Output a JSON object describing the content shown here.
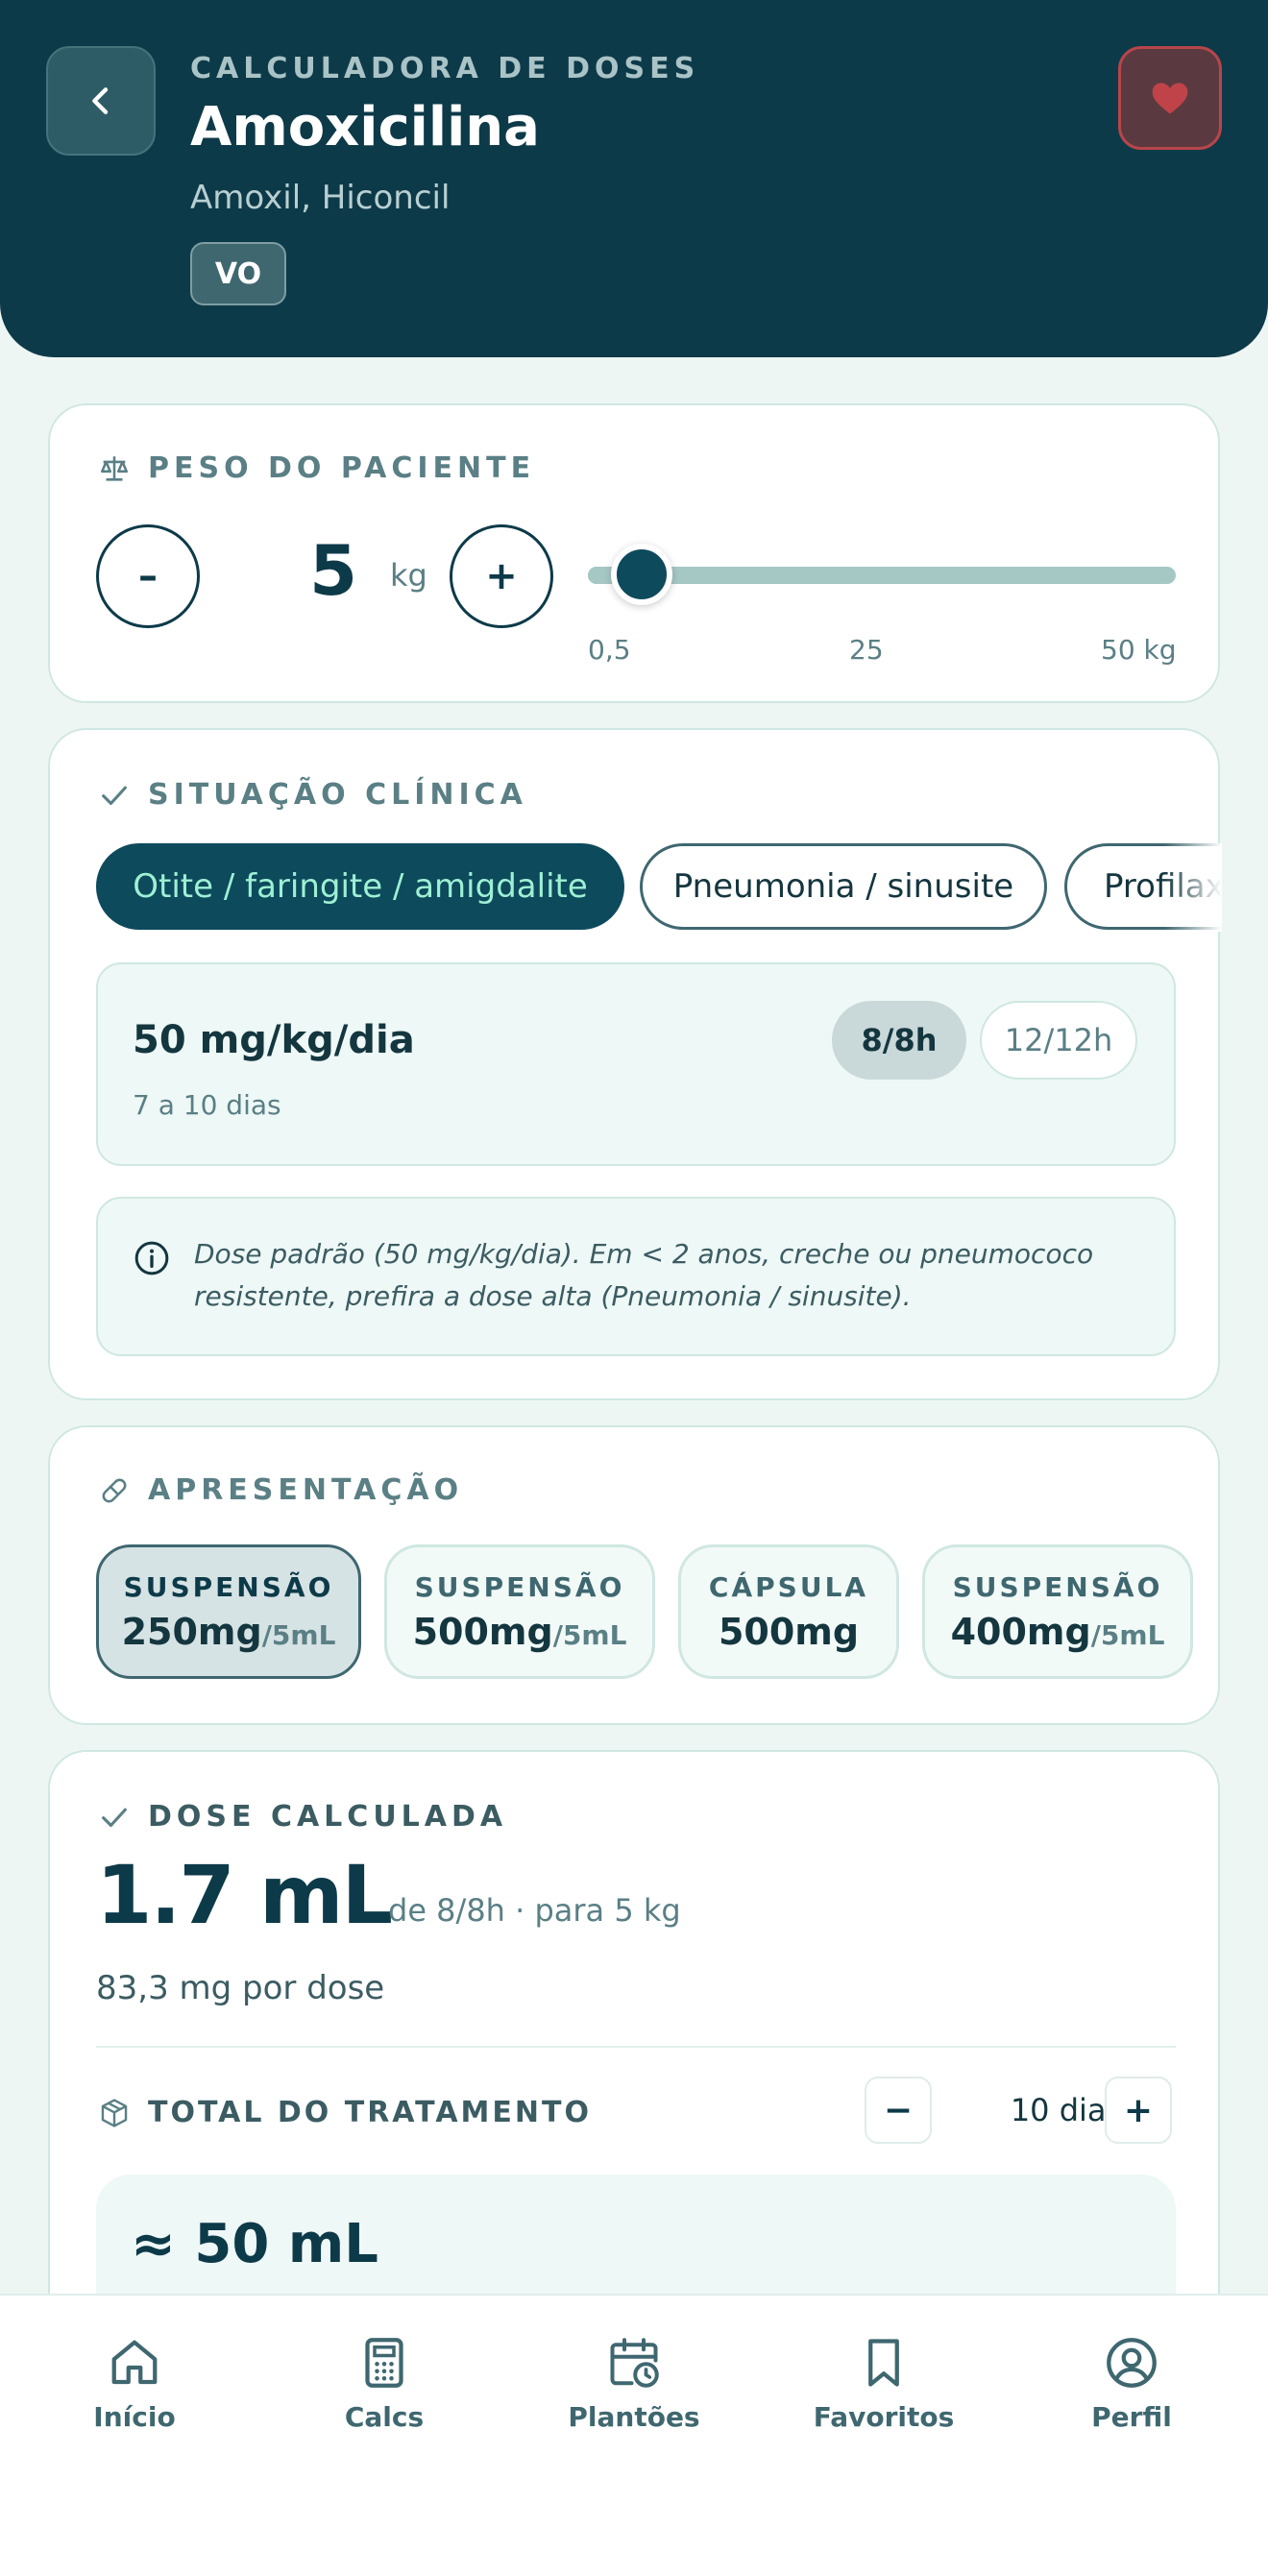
{
  "header": {
    "kicker": "CALCULADORA DE DOSES",
    "drug_name": "Amoxicilina",
    "brands": "Amoxil, Hiconcil",
    "route": "VO",
    "accent": "#0d3a49",
    "favorite_color": "#c0434a"
  },
  "weight": {
    "title": "PESO DO PACIENTE",
    "minus": "–",
    "plus": "+",
    "value": "5",
    "unit": "kg",
    "slider_value_kg": 5,
    "slider_min_kg": 0.5,
    "slider_max_kg": 50,
    "ticks": [
      "0,5",
      "25",
      "50 kg"
    ]
  },
  "clinical": {
    "title": "SITUAÇÃO CLÍNICA",
    "chips": [
      "Otite / faringite / amigdalite",
      "Pneumonia / sinusite",
      "Profilaxia"
    ],
    "dose_rule": "50 mg/kg/dia",
    "duration": "7 a 10 dias",
    "intervals": [
      "8/8h",
      "12/12h"
    ],
    "info": "Dose padrão (50 mg/kg/dia). Em < 2 anos, creche ou pneumococo resistente, prefira a dose alta (Pneumonia / sinusite)."
  },
  "presentation": {
    "title": "APRESENTAÇÃO",
    "items": [
      {
        "type": "SUSPENSÃO",
        "amount": "250mg",
        "per": "/5mL"
      },
      {
        "type": "SUSPENSÃO",
        "amount": "500mg",
        "per": "/5mL"
      },
      {
        "type": "CÁPSULA",
        "amount": "500mg",
        "per": ""
      },
      {
        "type": "SUSPENSÃO",
        "amount": "400mg",
        "per": "/5mL"
      }
    ]
  },
  "result": {
    "title": "DOSE CALCULADA",
    "dose": "1.7 mL",
    "context": "de 8/8h · para 5 kg",
    "per_dose": "83,3 mg por dose",
    "total_title": "TOTAL DO TRATAMENTO",
    "minus": "−",
    "plus": "+",
    "days": "10 dias",
    "total": "≈ 50 mL"
  },
  "tabs": [
    "Início",
    "Calcs",
    "Plantões",
    "Favoritos",
    "Perfil"
  ]
}
